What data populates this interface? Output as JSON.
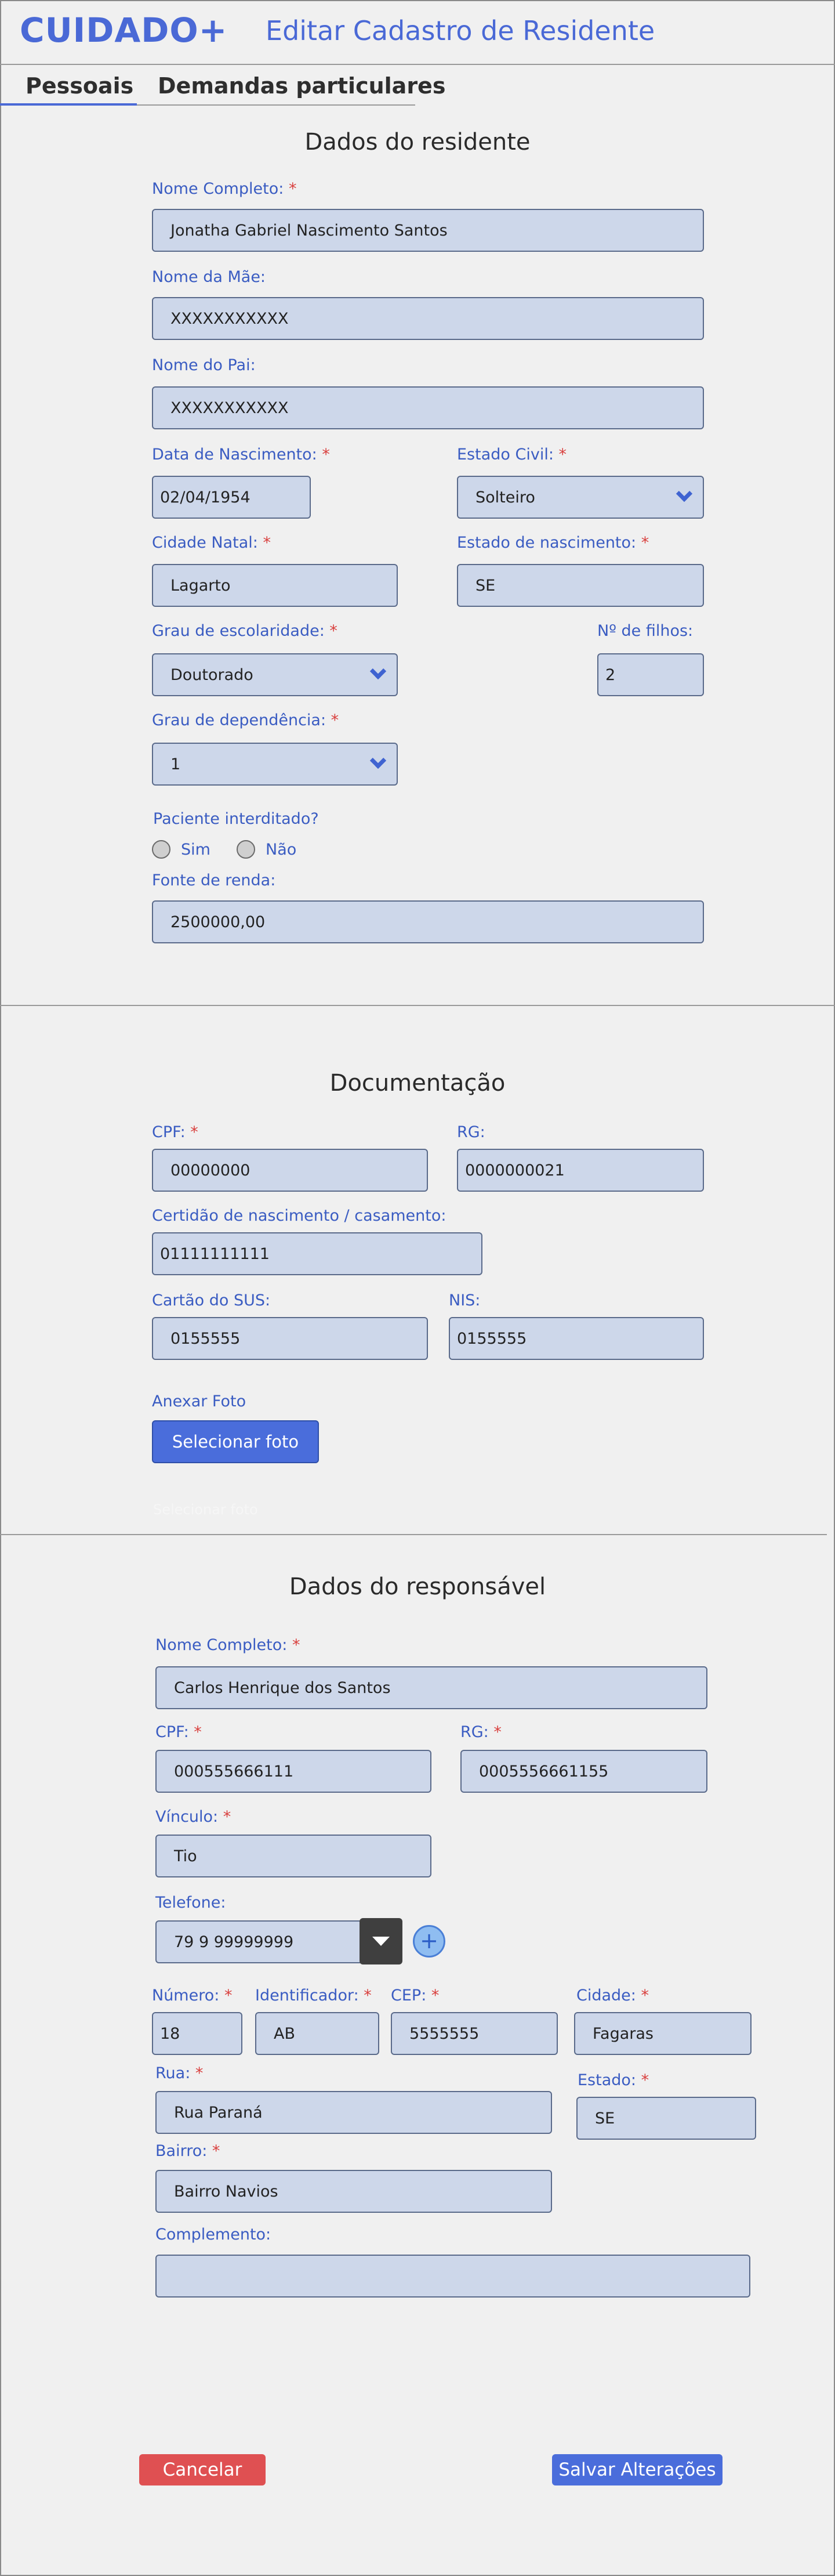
{
  "header": {
    "brand": "CUIDADO+",
    "title": "Editar Cadastro de Residente"
  },
  "tabs": [
    {
      "label": "Pessoais",
      "active": true
    },
    {
      "label": "Demandas particulares",
      "active": false
    }
  ],
  "resident": {
    "title": "Dados do residente",
    "nome_label": "Nome Completo:",
    "nome_value": "Jonatha Gabriel Nascimento Santos",
    "mae_label": "Nome da Mãe:",
    "mae_value": "XXXXXXXXXXX",
    "pai_label": "Nome do Pai:",
    "pai_value": "XXXXXXXXXXX",
    "nasc_label": "Data de Nascimento:",
    "nasc_value": "02/04/1954",
    "civil_label": "Estado Civil:",
    "civil_value": "Solteiro",
    "cidade_label": "Cidade Natal:",
    "cidade_value": "Lagarto",
    "estado_nasc_label": "Estado de nascimento:",
    "estado_nasc_value": "SE",
    "escolaridade_label": "Grau de escolaridade:",
    "escolaridade_value": "Doutorado",
    "filhos_label": "Nº de filhos:",
    "filhos_value": "2",
    "dependencia_label": "Grau de dependência:",
    "dependencia_value": "1",
    "interditado_label": "Paciente interditado?",
    "sim_label": "Sim",
    "nao_label": "Não",
    "renda_label": "Fonte de renda:",
    "renda_value": "2500000,00",
    "required_mark": "*"
  },
  "docs": {
    "title": "Documentação",
    "cpf_label": "CPF:",
    "cpf_value": "00000000",
    "rg_label": "RG:",
    "rg_value": "0000000021",
    "certidao_label": "Certidão de nascimento / casamento:",
    "certidao_value": "01111111111",
    "sus_label": "Cartão do SUS:",
    "sus_value": "0155555",
    "nis_label": "NIS:",
    "nis_value": "0155555",
    "foto_label": "Anexar Foto",
    "foto_button": "Selecionar foto",
    "ghost_text": "Selecionar foto"
  },
  "responsavel": {
    "title": "Dados do responsável",
    "nome_label": "Nome Completo:",
    "nome_value": "Carlos Henrique dos Santos",
    "cpf_label": "CPF:",
    "cpf_value": "000555666111",
    "rg_label": "RG:",
    "rg_value": "0005556661155",
    "vinculo_label": "Vínculo:",
    "vinculo_value": "Tio",
    "telefone_label": "Telefone:",
    "telefone_value": "79 9 99999999",
    "add_symbol": "+",
    "numero_label": "Número:",
    "numero_value": "18",
    "ident_label": "Identificador:",
    "ident_value": "AB",
    "cep_label": "CEP:",
    "cep_value": "5555555",
    "cidade_label": "Cidade:",
    "cidade_value": "Fagaras",
    "rua_label": "Rua:",
    "rua_value": "Rua Paraná",
    "estado_label": "Estado:",
    "estado_value": "SE",
    "bairro_label": "Bairro:",
    "bairro_value": "Bairro Navios",
    "complemento_label": "Complemento:",
    "complemento_value": ""
  },
  "actions": {
    "cancel": "Cancelar",
    "save": "Salvar Alterações"
  },
  "colors": {
    "accent": "#4a69d6",
    "required": "#d9403e",
    "field_bg": "#cdd7ea",
    "cancel": "#df5052",
    "page_bg": "#f0f0f0"
  }
}
